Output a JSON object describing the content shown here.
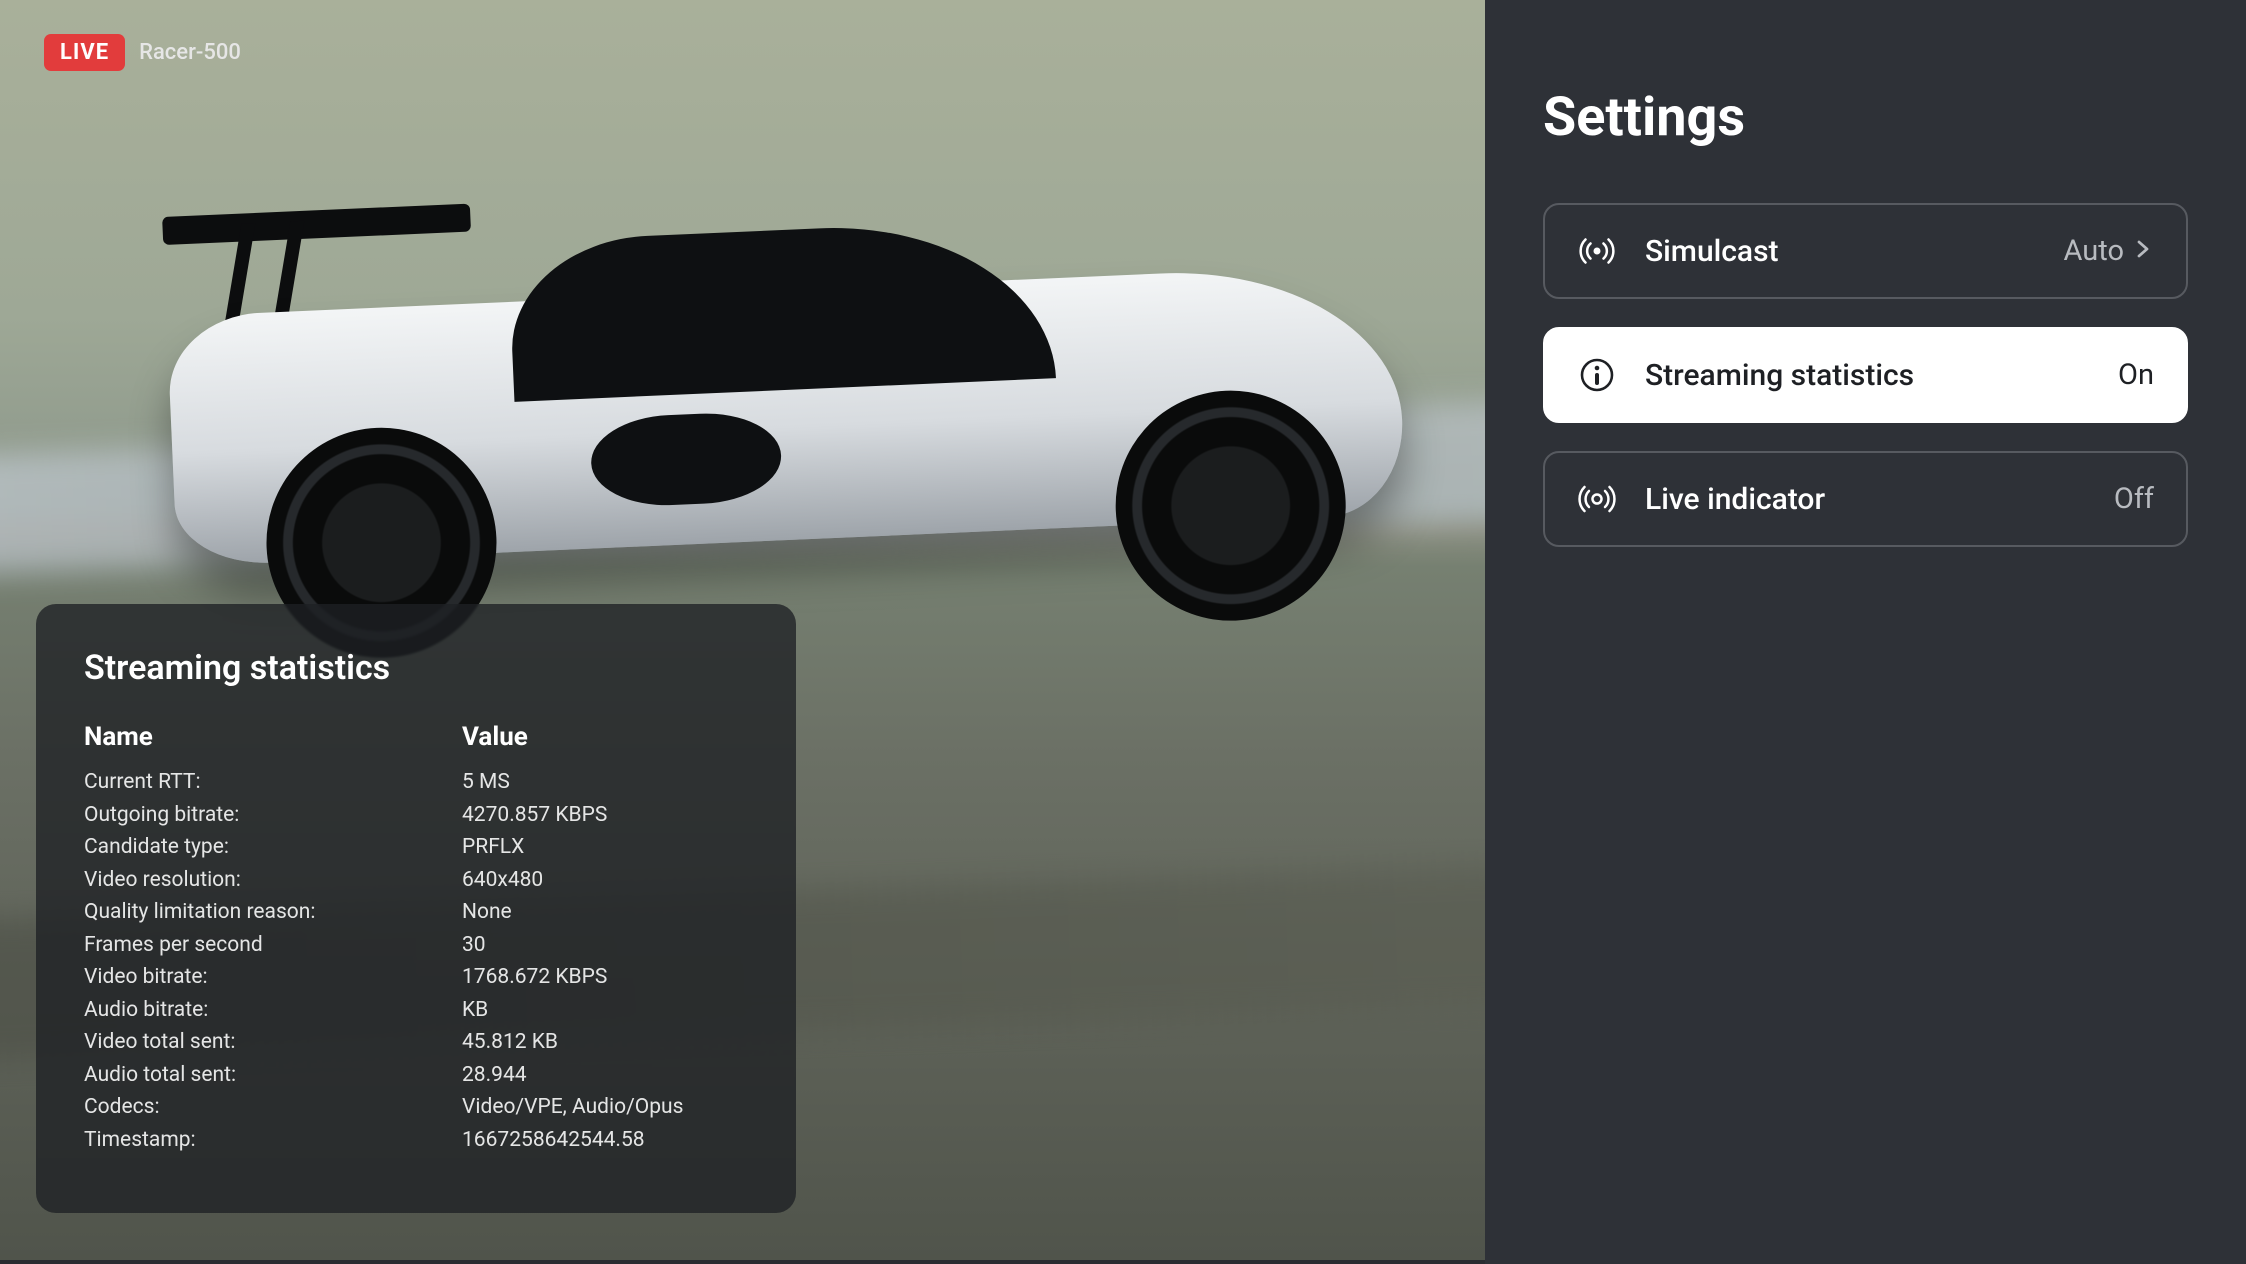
{
  "live": {
    "badge": "LIVE",
    "stream_name": "Racer-500"
  },
  "stats": {
    "title": "Streaming statistics",
    "col_name": "Name",
    "col_value": "Value",
    "rows": [
      {
        "name": "Current RTT:",
        "value": "5 MS"
      },
      {
        "name": "Outgoing bitrate:",
        "value": "4270.857 KBPS"
      },
      {
        "name": "Candidate type:",
        "value": "PRFLX"
      },
      {
        "name": "Video resolution:",
        "value": "640x480"
      },
      {
        "name": "Quality limitation reason:",
        "value": "None"
      },
      {
        "name": "Frames per second",
        "value": "30"
      },
      {
        "name": "Video bitrate:",
        "value": "1768.672 KBPS"
      },
      {
        "name": "Audio bitrate:",
        "value": "KB"
      },
      {
        "name": "Video total sent:",
        "value": "45.812 KB"
      },
      {
        "name": "Audio total sent:",
        "value": "28.944"
      },
      {
        "name": "Codecs:",
        "value": "Video/VPE, Audio/Opus"
      },
      {
        "name": "Timestamp:",
        "value": "1667258642544.58"
      }
    ]
  },
  "settings": {
    "title": "Settings",
    "items": [
      {
        "label": "Simulcast",
        "value": "Auto",
        "icon": "broadcast-icon",
        "active": false,
        "chevron": true
      },
      {
        "label": "Streaming statistics",
        "value": "On",
        "icon": "info-icon",
        "active": true,
        "chevron": false
      },
      {
        "label": "Live indicator",
        "value": "Off",
        "icon": "live-icon",
        "active": false,
        "chevron": false
      }
    ]
  }
}
